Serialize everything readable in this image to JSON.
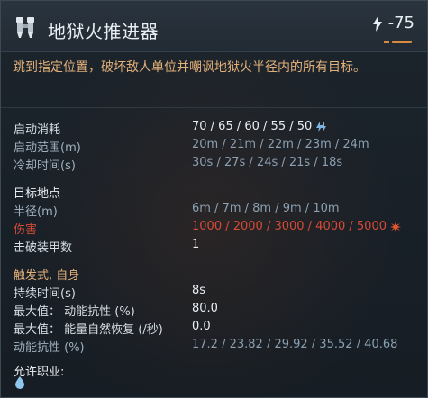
{
  "header": {
    "title": "地狱火推进器",
    "cost": "-75",
    "icon": "jetpack-icon",
    "cost_icon": "lightning-icon"
  },
  "description": "跳到指定位置，破坏敌人单位并嘲讽地狱火半径内的所有目标。",
  "sections": {
    "activation": {
      "title": "启动消耗",
      "rows": [
        {
          "label": "启动范围(m)",
          "value": "20m / 21m / 22m / 23m / 24m"
        },
        {
          "label": "冷却时间(s)",
          "value": "30s / 27s / 24s / 21s / 18s"
        }
      ],
      "cost_value": "70 / 65 / 60 / 55 / 50"
    },
    "target": {
      "title": "目标地点",
      "rows": [
        {
          "label": "半径(m)",
          "value": "6m / 7m / 8m / 9m / 10m"
        },
        {
          "label": "伤害",
          "value": "1000 / 2000 / 3000 / 4000 / 5000"
        },
        {
          "label": "击破装甲数",
          "value": "1"
        }
      ]
    },
    "trigger": {
      "title": "触发式, 自身",
      "rows": [
        {
          "label": "持续时间(s)",
          "value": "8s"
        },
        {
          "label": "最大值： 动能抗性 (%)",
          "value": "80.0"
        },
        {
          "label": "最大值： 能量自然恢复 (/秒)",
          "value": "0.0"
        },
        {
          "label": "动能抗性 (%)",
          "value": "17.2 / 23.82 / 29.92 / 35.52 / 40.68"
        }
      ]
    },
    "jobs": {
      "title": "允许职业:",
      "icon": "water-drop-icon"
    }
  },
  "colors": {
    "accent_orange": "#e2b07a",
    "damage_red": "#d44a36",
    "background": "#161d24"
  }
}
